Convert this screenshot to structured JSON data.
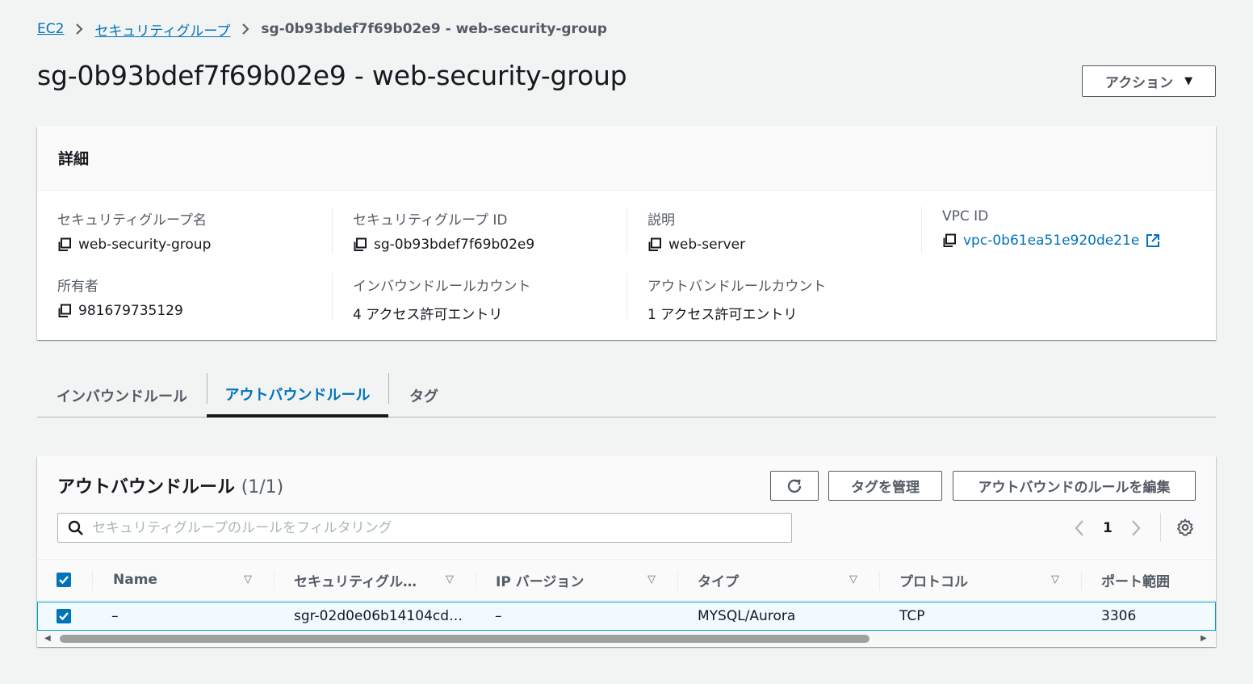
{
  "breadcrumb": {
    "ec2": "EC2",
    "security_groups": "セキュリティグループ",
    "current": "sg-0b93bdef7f69b02e9 - web-security-group"
  },
  "page_title": "sg-0b93bdef7f69b02e9 - web-security-group",
  "actions_label": "アクション",
  "details": {
    "heading": "詳細",
    "sg_name_label": "セキュリティグループ名",
    "sg_name_value": "web-security-group",
    "sg_id_label": "セキュリティグループ ID",
    "sg_id_value": "sg-0b93bdef7f69b02e9",
    "description_label": "説明",
    "description_value": "web-server",
    "vpc_label": "VPC ID",
    "vpc_value": "vpc-0b61ea51e920de21e",
    "owner_label": "所有者",
    "owner_value": "981679735129",
    "inbound_count_label": "インバウンドルールカウント",
    "inbound_count_value": "4 アクセス許可エントリ",
    "outbound_count_label": "アウトバンドルールカウント",
    "outbound_count_value": "1 アクセス許可エントリ"
  },
  "tabs": [
    {
      "label": "インバウンドルール"
    },
    {
      "label": "アウトバウンドルール"
    },
    {
      "label": "タグ"
    }
  ],
  "rules": {
    "title": "アウトバウンドルール",
    "count": "(1/1)",
    "manage_tags_label": "タグを管理",
    "edit_rules_label": "アウトバウンドのルールを編集",
    "search_placeholder": "セキュリティグループのルールをフィルタリング",
    "page_number": "1",
    "columns": {
      "name": "Name",
      "sg_rule_id": "セキュリティグル…",
      "ip_version": "IP バージョン",
      "type": "タイプ",
      "protocol": "プロトコル",
      "port_range": "ポート範囲"
    },
    "rows": [
      {
        "name": "–",
        "sg_rule_id": "sgr-02d0e06b14104cd…",
        "ip_version": "–",
        "type": "MYSQL/Aurora",
        "protocol": "TCP",
        "port_range": "3306"
      }
    ]
  },
  "colors": {
    "link": "#0073bb",
    "text": "#16191f",
    "muted": "#545b64",
    "selected_row_bg": "#f1faff",
    "selected_row_border": "#00a1c9"
  }
}
